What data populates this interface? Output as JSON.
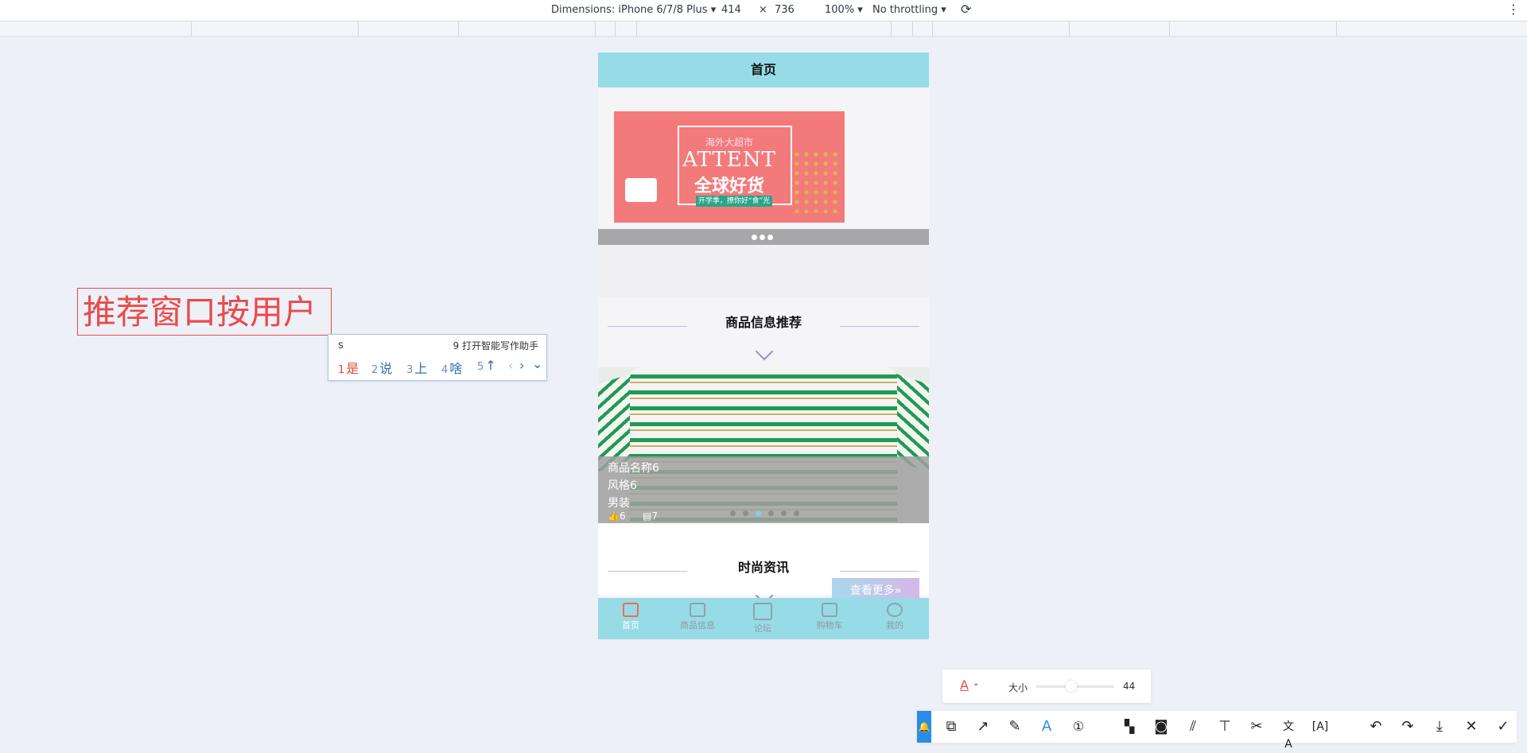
{
  "devtools": {
    "dimensions": "Dimensions: iPhone 6/7/8 Plus ▾",
    "width": "414",
    "times": "×",
    "height": "736",
    "zoom": "100% ▾",
    "throttling": "No throttling ▾",
    "rotate_icon": "⟳",
    "more_icon": "⋮"
  },
  "app": {
    "header_title": "首页",
    "banner": {
      "top_text": "海外大超市",
      "big_text": "ATTENT",
      "cn_text": "全球好货",
      "small_text": "开学季，撩你好“食”光"
    },
    "section1_title": "商品信息推荐",
    "product": {
      "name": "商品名称6",
      "style": "风格6",
      "category": "男装",
      "likes": "6",
      "comments": "7"
    },
    "section2_title": "时尚资讯",
    "more_button": "查看更多»",
    "tabs": [
      {
        "label": "首页",
        "icon": "home-icon"
      },
      {
        "label": "商品信息",
        "icon": "grid-icon"
      },
      {
        "label": "论坛",
        "icon": "chat-icon"
      },
      {
        "label": "购物车",
        "icon": "cart-icon"
      },
      {
        "label": "我的",
        "icon": "user-icon"
      }
    ]
  },
  "annotation": {
    "text": "推荐窗口按用户"
  },
  "ime": {
    "composition": "s",
    "assistant": "9 打开智能写作助手",
    "candidates": [
      {
        "num": "1",
        "text": "是"
      },
      {
        "num": "2",
        "text": "说"
      },
      {
        "num": "3",
        "text": "上"
      },
      {
        "num": "4",
        "text": "啥"
      },
      {
        "num": "5",
        "text": "↑"
      }
    ],
    "prev_icon": "‹",
    "next_icon": "›",
    "expand_icon": "⌄"
  },
  "screenshot_tool": {
    "size_label": "大小",
    "size_value": "44",
    "size_level": 0.44,
    "color_icon": "A",
    "text_color": "#e84b4b",
    "accent_color": "#2a8ce6",
    "tools": [
      "pin-icon",
      "shape-icon",
      "arrow-icon",
      "pen-icon",
      "text-icon",
      "number-icon",
      "mosaic-icon",
      "blur-icon",
      "hatch-icon",
      "pin-top-icon",
      "cut-icon",
      "translate-icon",
      "ocr-icon",
      "undo-icon",
      "redo-icon",
      "download-icon",
      "close-icon",
      "confirm-icon"
    ]
  }
}
